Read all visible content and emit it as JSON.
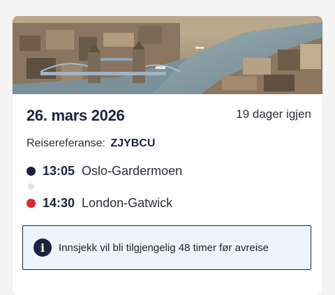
{
  "trip": {
    "date": "26. mars 2026",
    "days_left": "19 dager igjen",
    "reference_label": "Reisereferanse:",
    "reference_code": "ZJYBCU",
    "departure": {
      "time": "13:05",
      "place": "Oslo-Gardermoen"
    },
    "arrival": {
      "time": "14:30",
      "place": "London-Gatwick"
    },
    "info_message": "Innsjekk vil bli tilgjengelig 48 timer før avreise"
  },
  "colors": {
    "navy": "#1b2340",
    "red": "#e0262f",
    "info_bg": "#eef4fb"
  },
  "icons": {
    "departure": "departure-dot-icon",
    "arrival": "arrival-dot-icon",
    "info": "info-icon"
  }
}
